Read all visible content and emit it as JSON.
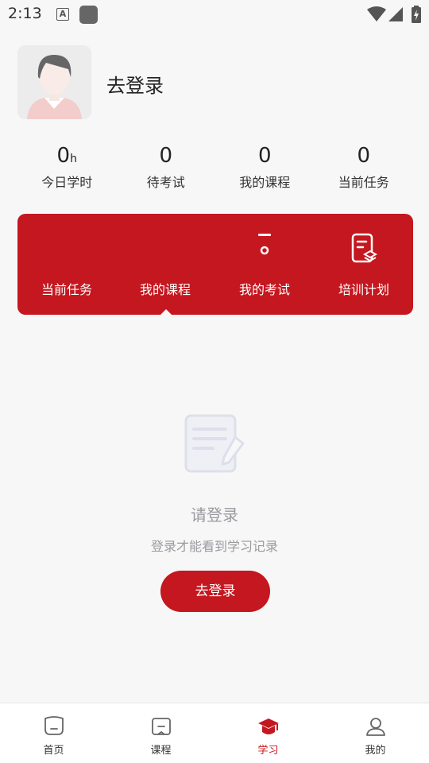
{
  "status_bar": {
    "time": "2:13",
    "a_badge": "A"
  },
  "profile": {
    "name": "去登录"
  },
  "stats": [
    {
      "value": "0",
      "unit": "h",
      "label": "今日学时"
    },
    {
      "value": "0",
      "unit": "",
      "label": "待考试"
    },
    {
      "value": "0",
      "unit": "",
      "label": "我的课程"
    },
    {
      "value": "0",
      "unit": "",
      "label": "当前任务"
    }
  ],
  "tabs": [
    {
      "label": "当前任务",
      "icon": "task-icon"
    },
    {
      "label": "我的课程",
      "icon": "course-icon",
      "selected": true
    },
    {
      "label": "我的考试",
      "icon": "exam-icon"
    },
    {
      "label": "培训计划",
      "icon": "plan-icon"
    }
  ],
  "empty_state": {
    "title": "请登录",
    "subtitle": "登录才能看到学习记录",
    "button": "去登录"
  },
  "bottom_nav": [
    {
      "label": "首页",
      "icon": "home-icon"
    },
    {
      "label": "课程",
      "icon": "book-icon"
    },
    {
      "label": "学习",
      "icon": "graduation-cap-icon",
      "active": true
    },
    {
      "label": "我的",
      "icon": "user-icon"
    }
  ],
  "colors": {
    "accent": "#c4171f",
    "background": "#f7f7f7",
    "muted_text": "#9a9aa0"
  }
}
